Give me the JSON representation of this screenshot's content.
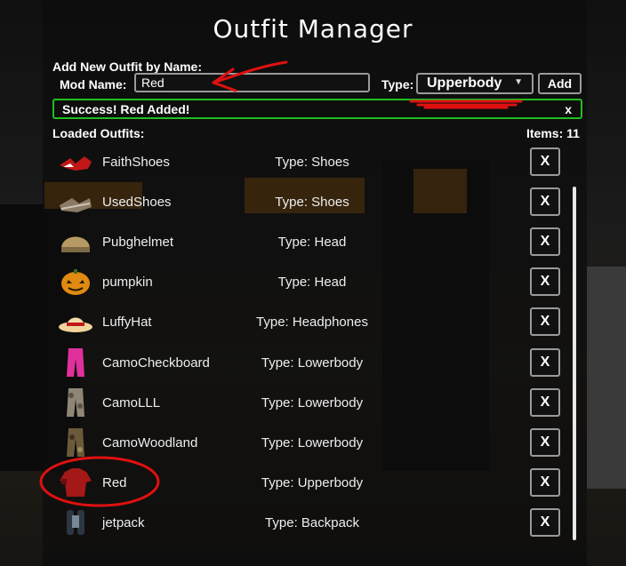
{
  "window": {
    "title": "Outfit Manager"
  },
  "form": {
    "section_label": "Add New Outfit by Name:",
    "mod_name_label": "Mod Name:",
    "mod_name_value": "Red",
    "type_label": "Type:",
    "type_value": "Upperbody",
    "add_label": "Add"
  },
  "notice": {
    "text": "Success! Red Added!",
    "close": "x"
  },
  "list": {
    "header": "Loaded Outfits:",
    "count": "Items: 11",
    "delete_label": "X",
    "items": [
      {
        "name": "FaithShoes",
        "type": "Type: Shoes",
        "icon": "red-shoes-icon"
      },
      {
        "name": "UsedShoes",
        "type": "Type: Shoes",
        "icon": "worn-shoes-icon"
      },
      {
        "name": "Pubghelmet",
        "type": "Type: Head",
        "icon": "helmet-icon"
      },
      {
        "name": "pumpkin",
        "type": "Type: Head",
        "icon": "pumpkin-icon"
      },
      {
        "name": "LuffyHat",
        "type": "Type: Headphones",
        "icon": "straw-hat-icon"
      },
      {
        "name": "CamoCheckboard",
        "type": "Type: Lowerbody",
        "icon": "pink-pants-icon"
      },
      {
        "name": "CamoLLL",
        "type": "Type: Lowerbody",
        "icon": "camo-pants-icon"
      },
      {
        "name": "CamoWoodland",
        "type": "Type: Lowerbody",
        "icon": "woodland-pants-icon"
      },
      {
        "name": "Red",
        "type": "Type: Upperbody",
        "icon": "red-shirt-icon"
      },
      {
        "name": "jetpack",
        "type": "Type: Backpack",
        "icon": "jetpack-icon"
      }
    ]
  },
  "colors": {
    "success_border": "#1fbf1f",
    "annotation": "#e01010",
    "accent_bg": "#b96f10"
  }
}
